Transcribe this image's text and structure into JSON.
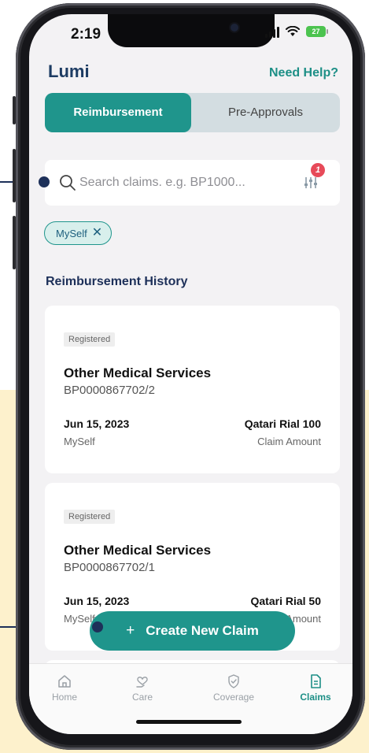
{
  "status_bar": {
    "time": "2:19",
    "battery": "27"
  },
  "header": {
    "brand": "Lumi",
    "help_link": "Need Help?"
  },
  "tabs": [
    {
      "label": "Reimbursement",
      "active": true
    },
    {
      "label": "Pre-Approvals",
      "active": false
    }
  ],
  "search": {
    "placeholder": "Search claims. e.g. BP1000...",
    "value": "",
    "filter_badge_count": "1"
  },
  "filter_chips": [
    {
      "label": "MySelf"
    }
  ],
  "section": {
    "title": "Reimbursement History"
  },
  "claims": [
    {
      "status": "Registered",
      "title": "Other Medical Services",
      "reference": "BP0000867702/2",
      "date": "Jun 15, 2023",
      "member": "MySelf",
      "amount": "Qatari Rial 100",
      "amount_label": "Claim Amount"
    },
    {
      "status": "Registered",
      "title": "Other Medical Services",
      "reference": "BP0000867702/1",
      "date": "Jun 15, 2023",
      "member": "MySelf",
      "amount": "Qatari Rial 50",
      "amount_label": "Claim Amount"
    }
  ],
  "fab": {
    "label": "Create New Claim",
    "icon": "plus-icon"
  },
  "tab_bar": [
    {
      "label": "Home",
      "icon": "home-icon",
      "active": false
    },
    {
      "label": "Care",
      "icon": "heart-hand-icon",
      "active": false
    },
    {
      "label": "Coverage",
      "icon": "shield-check-icon",
      "active": false
    },
    {
      "label": "Claims",
      "icon": "document-icon",
      "active": true
    }
  ],
  "colors": {
    "accent": "#1f958c",
    "navy": "#1d3059",
    "badge_red": "#e74a59",
    "callout_background": "#fdf1cc"
  }
}
